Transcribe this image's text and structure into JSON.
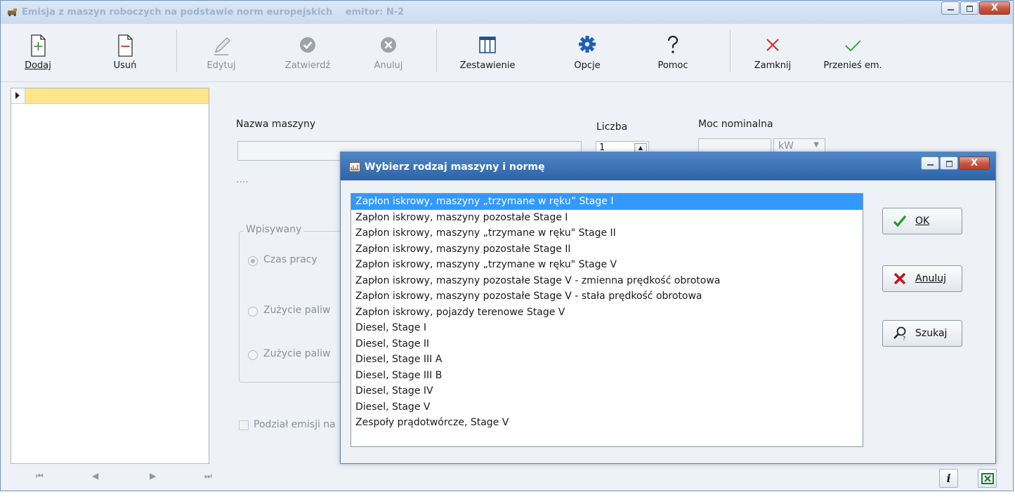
{
  "window": {
    "title": "Emisja z maszyn roboczych na podstawie norm europejskich",
    "emitter": "emitor: N-2",
    "close_glyph": "X"
  },
  "toolbar": {
    "add": "Dodaj",
    "remove": "Usuń",
    "edit": "Edytuj",
    "confirm": "Zatwierdź",
    "cancel": "Anuluj",
    "summary": "Zestawienie",
    "options": "Opcje",
    "help": "Pomoc",
    "close": "Zamknij",
    "transfer": "Przenieś em."
  },
  "form": {
    "machine_name_label": "Nazwa maszyny",
    "dots": "....",
    "count_label": "Liczba",
    "count_value": "1",
    "power_label": "Moc nominalna",
    "power_unit": "kW",
    "group_title": "Wpisywany",
    "radio_work_time": "Czas pracy",
    "radio_fuel_1": "Zużycie paliw",
    "radio_fuel_2": "Zużycie paliw",
    "split_checkbox": "Podział emisji na"
  },
  "dialog": {
    "title": "Wybierz rodzaj maszyny i normę",
    "close_glyph": "X",
    "items": [
      "Zapłon iskrowy, maszyny „trzymane w ręku” Stage I",
      "Zapłon iskrowy, maszyny pozostałe Stage I",
      "Zapłon iskrowy, maszyny  „trzymane w ręku\" Stage II",
      "Zapłon iskrowy, maszyny pozostałe Stage II",
      "Zapłon iskrowy, maszyny  „trzymane w ręku\" Stage  V",
      "Zapłon iskrowy, maszyny pozostałe Stage V  - zmienna prędkość obrotowa",
      "Zapłon iskrowy, maszyny pozostałe Stage V  - stała prędkość  obrotowa",
      "Zapłon iskrowy, pojazdy terenowe Stage V",
      "Diesel, Stage I",
      "Diesel, Stage II",
      "Diesel, Stage III A",
      "Diesel, Stage III B",
      "Diesel, Stage IV",
      "Diesel, Stage V",
      "Zespoły prądotwórcze, Stage V"
    ],
    "selected_index": 0,
    "ok_label": "OK",
    "cancel_label": "Anuluj",
    "search_label": "Szukaj"
  },
  "nav": {
    "first": "⏮",
    "prev": "◀",
    "next": "▶",
    "last": "⏭"
  },
  "status": {
    "info_glyph": "i"
  },
  "colors": {
    "selection": "#3399ff",
    "current_row": "#fde58a",
    "dialog_title": "#2e64a6"
  }
}
